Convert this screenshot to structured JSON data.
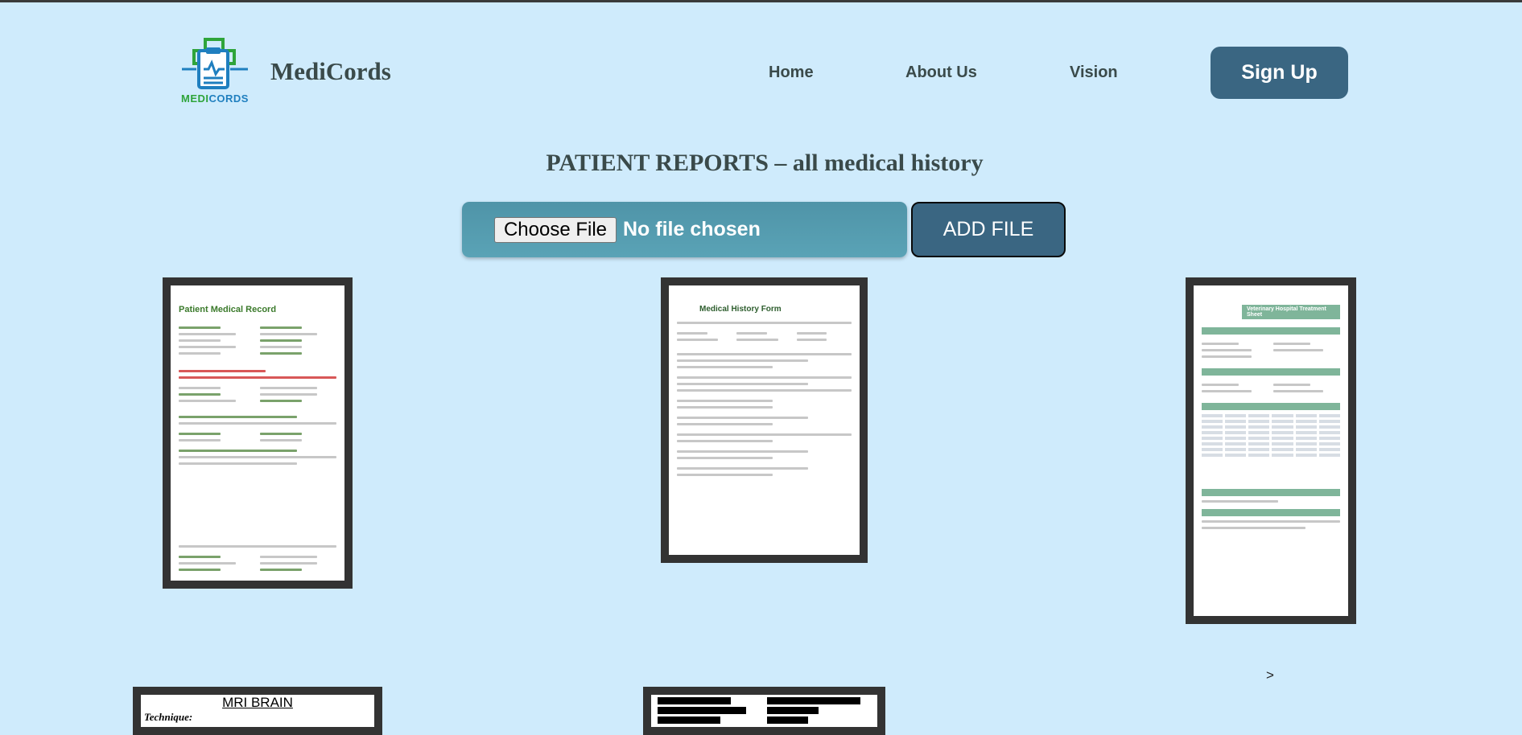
{
  "header": {
    "logo_label_part1": "MEDI",
    "logo_label_part2": "CORDS",
    "brand": "MediCords",
    "nav": [
      "Home",
      "About Us",
      "Vision"
    ],
    "signup_label": "Sign Up"
  },
  "main": {
    "title": "PATIENT REPORTS – all medical history",
    "upload": {
      "choose_label": "Choose File",
      "status": "No file chosen",
      "add_label": "ADD FILE"
    },
    "reports": [
      {
        "title": "Patient Medical Record"
      },
      {
        "title": "Medical History Form"
      },
      {
        "title": "Veterinary Hospital Treatment Sheet"
      },
      {
        "title": "MRI BRAIN",
        "subtitle": "Technique:"
      },
      {
        "title": ""
      }
    ],
    "next_label": ">"
  },
  "colors": {
    "background": "#cfebfc",
    "accent": "#3a6682",
    "upload_bar": "#5aa3b6",
    "text": "#3a4a4a"
  }
}
